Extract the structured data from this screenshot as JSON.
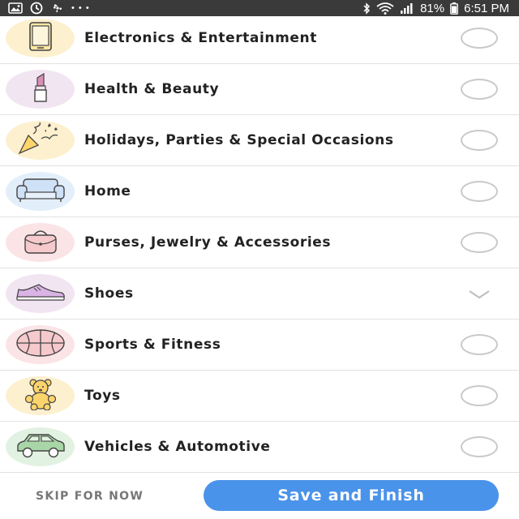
{
  "status_bar": {
    "battery": "81%",
    "time": "6:51 PM",
    "overflow": "• • •",
    "colors": {
      "background": "#3a3a3a",
      "foreground": "#ffffff"
    },
    "icons": [
      "image-icon",
      "sync-icon",
      "fan-icon",
      "bluetooth-icon",
      "wifi-icon",
      "signal-icon",
      "battery-icon"
    ]
  },
  "categories": [
    {
      "label": "Electronics & Entertainment",
      "icon": "phone-icon",
      "bubble_color": "#fdf0cf",
      "selected": false,
      "expanded": false
    },
    {
      "label": "Health & Beauty",
      "icon": "lipstick-icon",
      "bubble_color": "#f2e5f2",
      "selected": false,
      "expanded": false
    },
    {
      "label": "Holidays, Parties & Special Occasions",
      "icon": "party-popper-icon",
      "bubble_color": "#fdf0cf",
      "selected": false,
      "expanded": false
    },
    {
      "label": "Home",
      "icon": "armchair-icon",
      "bubble_color": "#e3eefb",
      "selected": false,
      "expanded": false
    },
    {
      "label": "Purses, Jewelry & Accessories",
      "icon": "purse-icon",
      "bubble_color": "#fbe4e6",
      "selected": false,
      "expanded": false
    },
    {
      "label": "Shoes",
      "icon": "sneaker-icon",
      "bubble_color": "#f2e5f2",
      "selected": false,
      "expanded": true
    },
    {
      "label": "Sports & Fitness",
      "icon": "basketball-icon",
      "bubble_color": "#fbe4e6",
      "selected": false,
      "expanded": false
    },
    {
      "label": "Toys",
      "icon": "teddy-bear-icon",
      "bubble_color": "#fdf0cf",
      "selected": false,
      "expanded": false
    },
    {
      "label": "Vehicles & Automotive",
      "icon": "car-icon",
      "bubble_color": "#e2f2e2",
      "selected": false,
      "expanded": false
    }
  ],
  "footer": {
    "skip_label": "SKIP FOR NOW",
    "save_label": "Save and Finish",
    "accent_color": "#4a93ea"
  }
}
